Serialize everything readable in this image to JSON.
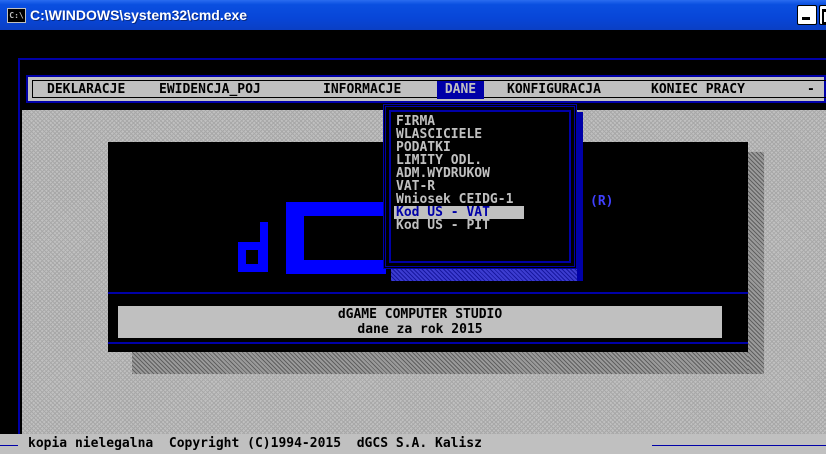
{
  "window": {
    "title": "C:\\WINDOWS\\system32\\cmd.exe",
    "icon_label": "C:\\"
  },
  "menubar": {
    "items": [
      {
        "label": "DEKLARACJE"
      },
      {
        "label": "EWIDENCJA_POJ"
      },
      {
        "label": "INFORMACJE"
      },
      {
        "label": " DANE "
      },
      {
        "label": "KONFIGURACJA"
      },
      {
        "label": "KONIEC PRACY"
      }
    ],
    "trailing": "-"
  },
  "dropdown": {
    "items": [
      {
        "label": "FIRMA"
      },
      {
        "label": "WLASCICIELE"
      },
      {
        "label": "PODATKI"
      },
      {
        "label": "LIMITY ODL."
      },
      {
        "label": "ADM.WYDRUKOW"
      },
      {
        "label": "VAT-R"
      },
      {
        "label": "Wniosek CEIDG-1"
      },
      {
        "label": "Kod US - VAT"
      },
      {
        "label": "Kod US - PIT"
      }
    ],
    "selected_index": 7
  },
  "splash": {
    "registered_mark": "(R)",
    "company": "dGAME COMPUTER STUDIO",
    "year_line": "dane za rok  2015"
  },
  "status": {
    "text": "kopia nielegalna  Copyright (C)1994-2015  dGCS S.A. Kalisz"
  },
  "colors": {
    "title_bar": "#0846d8",
    "dos_blue": "#0000a8",
    "dos_gray": "#c0c0c0",
    "logo_blue": "#0000ff"
  }
}
